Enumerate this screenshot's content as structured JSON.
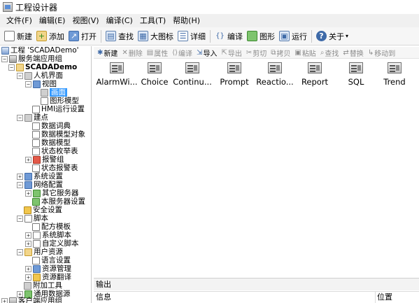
{
  "window": {
    "title": "工程设计器"
  },
  "menu": [
    "文件(F)",
    "编辑(E)",
    "视图(V)",
    "编译(C)",
    "工具(T)",
    "帮助(H)"
  ],
  "toolbar": {
    "new": "新建",
    "add": "添加",
    "open": "打开",
    "find": "查找",
    "large_icons": "大图标",
    "details": "详细",
    "compile": "编译",
    "graphics": "图形",
    "run": "运行",
    "about": "关于"
  },
  "tree": {
    "project": "工程 'SCADADemo'",
    "server_app": "服务端应用组",
    "scada_demo": "SCADADemo",
    "hmi": "人机界面",
    "views": "视图",
    "screens": "画面",
    "graphic_models": "图形模型",
    "hmi_runtime": "HMI运行设置",
    "points": "建点",
    "data_dict": "数据词典",
    "data_model_obj": "数据模型对象",
    "data_model": "数据模型",
    "state_enum": "状态枚举表",
    "alarm_group": "报警组",
    "state_alarm": "状态报警表",
    "system_settings": "系统设置",
    "network_config": "网络配置",
    "other_servers": "其它服务器",
    "local_server": "本服务器设置",
    "security": "安全设置",
    "scripts": "脚本",
    "recipe_template": "配方模板",
    "system_scripts": "系统脚本",
    "custom_scripts": "自定义脚本",
    "user_resources": "用户资源",
    "language": "语言设置",
    "resource_mgmt": "资源管理",
    "resource_translate": "资源翻译",
    "addon_tools": "附加工具",
    "general_datasource": "通用数据源",
    "client_app": "客户端应用组"
  },
  "content_toolbar": {
    "new": "新建",
    "delete": "删除",
    "properties": "属性",
    "compile": "编译",
    "import": "导入",
    "export": "导出",
    "cut": "剪切",
    "copy": "拷贝",
    "paste": "粘贴",
    "find": "查找",
    "replace": "替换",
    "move_to": "移动到"
  },
  "content_items": [
    "AlarmWi...",
    "Choice",
    "Continu...",
    "Prompt",
    "Reactio...",
    "Report",
    "SQL",
    "Trend"
  ],
  "output": {
    "title": "输出",
    "col_info": "信息",
    "col_position": "位置"
  }
}
